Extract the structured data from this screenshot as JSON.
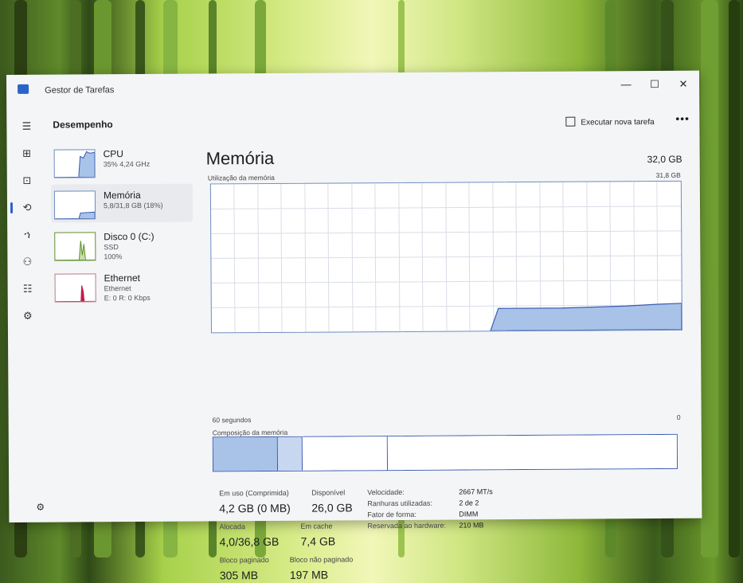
{
  "window": {
    "title": "Gestor de Tarefas",
    "minimize": "—",
    "maximize": "☐",
    "close": "✕"
  },
  "header": {
    "title": "Desempenho",
    "run_task": "Executar nova tarefa",
    "more": "•••"
  },
  "rail": {
    "menu": "☰",
    "processes": "⊞",
    "performance": "⊡",
    "history": "⟲",
    "startup": "ኀ",
    "users": "⚇",
    "details": "☷",
    "services": "⚙",
    "settings": "⚙"
  },
  "sidebar": {
    "items": [
      {
        "name": "CPU",
        "sub1": "35% 4,24 GHz",
        "sub2": ""
      },
      {
        "name": "Memória",
        "sub1": "5,8/31,8 GB (18%)",
        "sub2": ""
      },
      {
        "name": "Disco 0 (C:)",
        "sub1": "SSD",
        "sub2": "100%"
      },
      {
        "name": "Ethernet",
        "sub1": "Ethernet",
        "sub2": "E: 0 R: 0 Kbps"
      }
    ]
  },
  "main": {
    "title": "Memória",
    "total": "32,0 GB",
    "usage_caption": "Utilização da memória",
    "usage_max": "31,8 GB",
    "time_left": "60 segundos",
    "time_right": "0",
    "composition_caption": "Composição da memória",
    "stats": {
      "in_use_label": "Em uso (Comprimida)",
      "in_use_value": "4,2 GB (0 MB)",
      "available_label": "Disponível",
      "available_value": "26,0 GB",
      "committed_label": "Alocada",
      "committed_value": "4,0/36,8 GB",
      "cached_label": "Em cache",
      "cached_value": "7,4 GB",
      "paged_label": "Bloco paginado",
      "paged_value": "305 MB",
      "nonpaged_label": "Bloco não paginado",
      "nonpaged_value": "197 MB"
    },
    "details": {
      "speed_label": "Velocidade:",
      "speed_value": "2667 MT/s",
      "slots_label": "Ranhuras utilizadas:",
      "slots_value": "2 de 2",
      "form_label": "Fator de forma:",
      "form_value": "DIMM",
      "reserved_label": "Reservada ao hardware:",
      "reserved_value": "210 MB"
    }
  },
  "colors": {
    "accent": "#2b63c9",
    "graph_fill": "#a9c3e8",
    "graph_line": "#3a5ab0",
    "disk_line": "#5e8f2c",
    "eth_fill": "#c21f4a"
  }
}
